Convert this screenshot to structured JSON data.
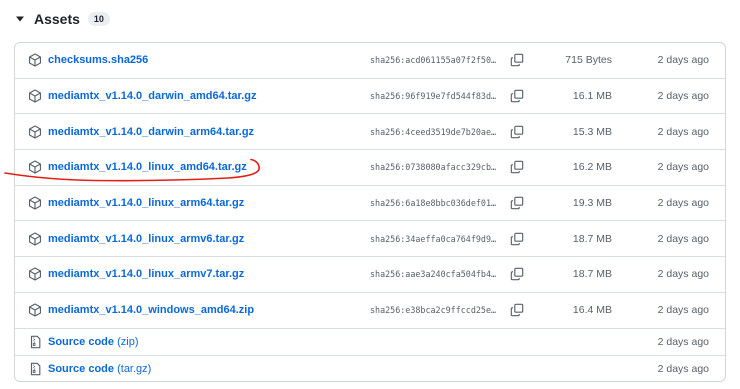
{
  "header": {
    "title": "Assets",
    "count": "10"
  },
  "assets": [
    {
      "name": "checksums.sha256",
      "sha": "sha256:acd061155a07f2f50…",
      "size": "715 Bytes",
      "date": "2 days ago",
      "icon": "package-icon"
    },
    {
      "name": "mediamtx_v1.14.0_darwin_amd64.tar.gz",
      "sha": "sha256:96f919e7fd544f83d…",
      "size": "16.1 MB",
      "date": "2 days ago",
      "icon": "package-icon"
    },
    {
      "name": "mediamtx_v1.14.0_darwin_arm64.tar.gz",
      "sha": "sha256:4ceed3519de7b20ae…",
      "size": "15.3 MB",
      "date": "2 days ago",
      "icon": "package-icon"
    },
    {
      "name": "mediamtx_v1.14.0_linux_amd64.tar.gz",
      "sha": "sha256:0738080afacc329cb…",
      "size": "16.2 MB",
      "date": "2 days ago",
      "icon": "package-icon",
      "annotated": true
    },
    {
      "name": "mediamtx_v1.14.0_linux_arm64.tar.gz",
      "sha": "sha256:6a18e8bbc036def01…",
      "size": "19.3 MB",
      "date": "2 days ago",
      "icon": "package-icon"
    },
    {
      "name": "mediamtx_v1.14.0_linux_armv6.tar.gz",
      "sha": "sha256:34aeffa0ca764f9d9…",
      "size": "18.7 MB",
      "date": "2 days ago",
      "icon": "package-icon"
    },
    {
      "name": "mediamtx_v1.14.0_linux_armv7.tar.gz",
      "sha": "sha256:aae3a240cfa504fb4…",
      "size": "18.7 MB",
      "date": "2 days ago",
      "icon": "package-icon"
    },
    {
      "name": "mediamtx_v1.14.0_windows_amd64.zip",
      "sha": "sha256:e38bca2c9ffccd25e…",
      "size": "16.4 MB",
      "date": "2 days ago",
      "icon": "package-icon"
    }
  ],
  "source_code": [
    {
      "name": "Source code",
      "suffix": "(zip)",
      "date": "2 days ago",
      "icon": "file-zip-icon"
    },
    {
      "name": "Source code",
      "suffix": "(tar.gz)",
      "date": "2 days ago",
      "icon": "file-zip-icon"
    }
  ],
  "colors": {
    "link": "#0969da",
    "muted": "#57606a",
    "border": "#d0d7de",
    "annotation": "#e0201a"
  }
}
